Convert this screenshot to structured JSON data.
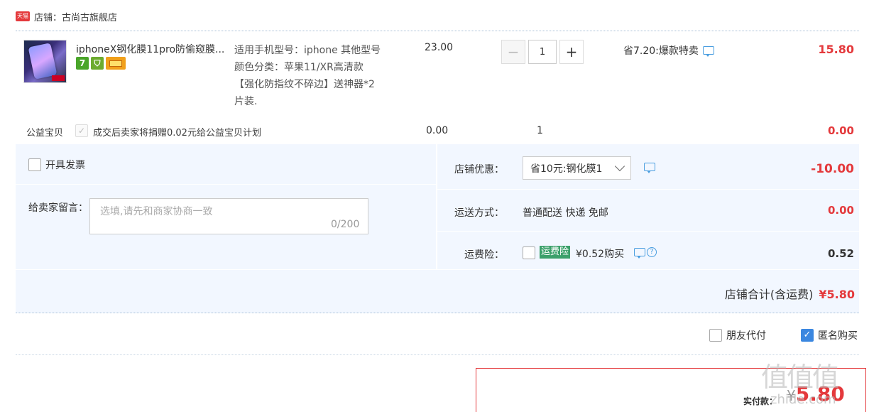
{
  "shop": {
    "badge": "天猫",
    "name": "店铺：古尚古旗舰店"
  },
  "item": {
    "title": "iphoneX钢化膜11pro防偷窥膜...",
    "spec_lines": [
      "适用手机型号：iphone 其他型号",
      "颜色分类：苹果11/XR高清款",
      "【强化防指纹不碎边】送神器*2",
      "片装."
    ],
    "unit_price": "23.00",
    "quantity": "1",
    "promo": "省7.20:爆款特卖",
    "total": "15.80",
    "service_icons": [
      "seven-day-return-icon",
      "guarantee-icon",
      "credit-card-icon"
    ]
  },
  "charity": {
    "label": "公益宝贝",
    "text": "成交后卖家将捐赠0.02元给公益宝贝计划",
    "price": "0.00",
    "quantity": "1",
    "total": "0.00"
  },
  "invoice": {
    "label": "开具发票"
  },
  "message": {
    "label": "给卖家留言：",
    "placeholder": "选填,请先和商家协商一致",
    "count": "0/200"
  },
  "coupon": {
    "label": "店铺优惠：",
    "selected": "省10元:钢化膜1",
    "value": "-10.00"
  },
  "shipping": {
    "label": "运送方式：",
    "method": "普通配送 快递 免邮",
    "value": "0.00"
  },
  "insurance": {
    "label": "运费险：",
    "badge": "运费险",
    "price": "¥0.52购买",
    "value": "0.52"
  },
  "shop_total": {
    "label": "店铺合计(含运费)",
    "value": "¥5.80"
  },
  "options": {
    "friend_pay": "朋友代付",
    "anonymous": "匿名购买"
  },
  "pay": {
    "label": "实付款：",
    "currency": "¥",
    "value": "5.80"
  },
  "watermark": {
    "main": "值值值",
    "sub": "zhide.com"
  },
  "colors": {
    "accent_red": "#e4393c",
    "panel_blue": "#f2f7ff",
    "check_blue": "#3b87e0",
    "insurance_green": "#3ca06b"
  }
}
